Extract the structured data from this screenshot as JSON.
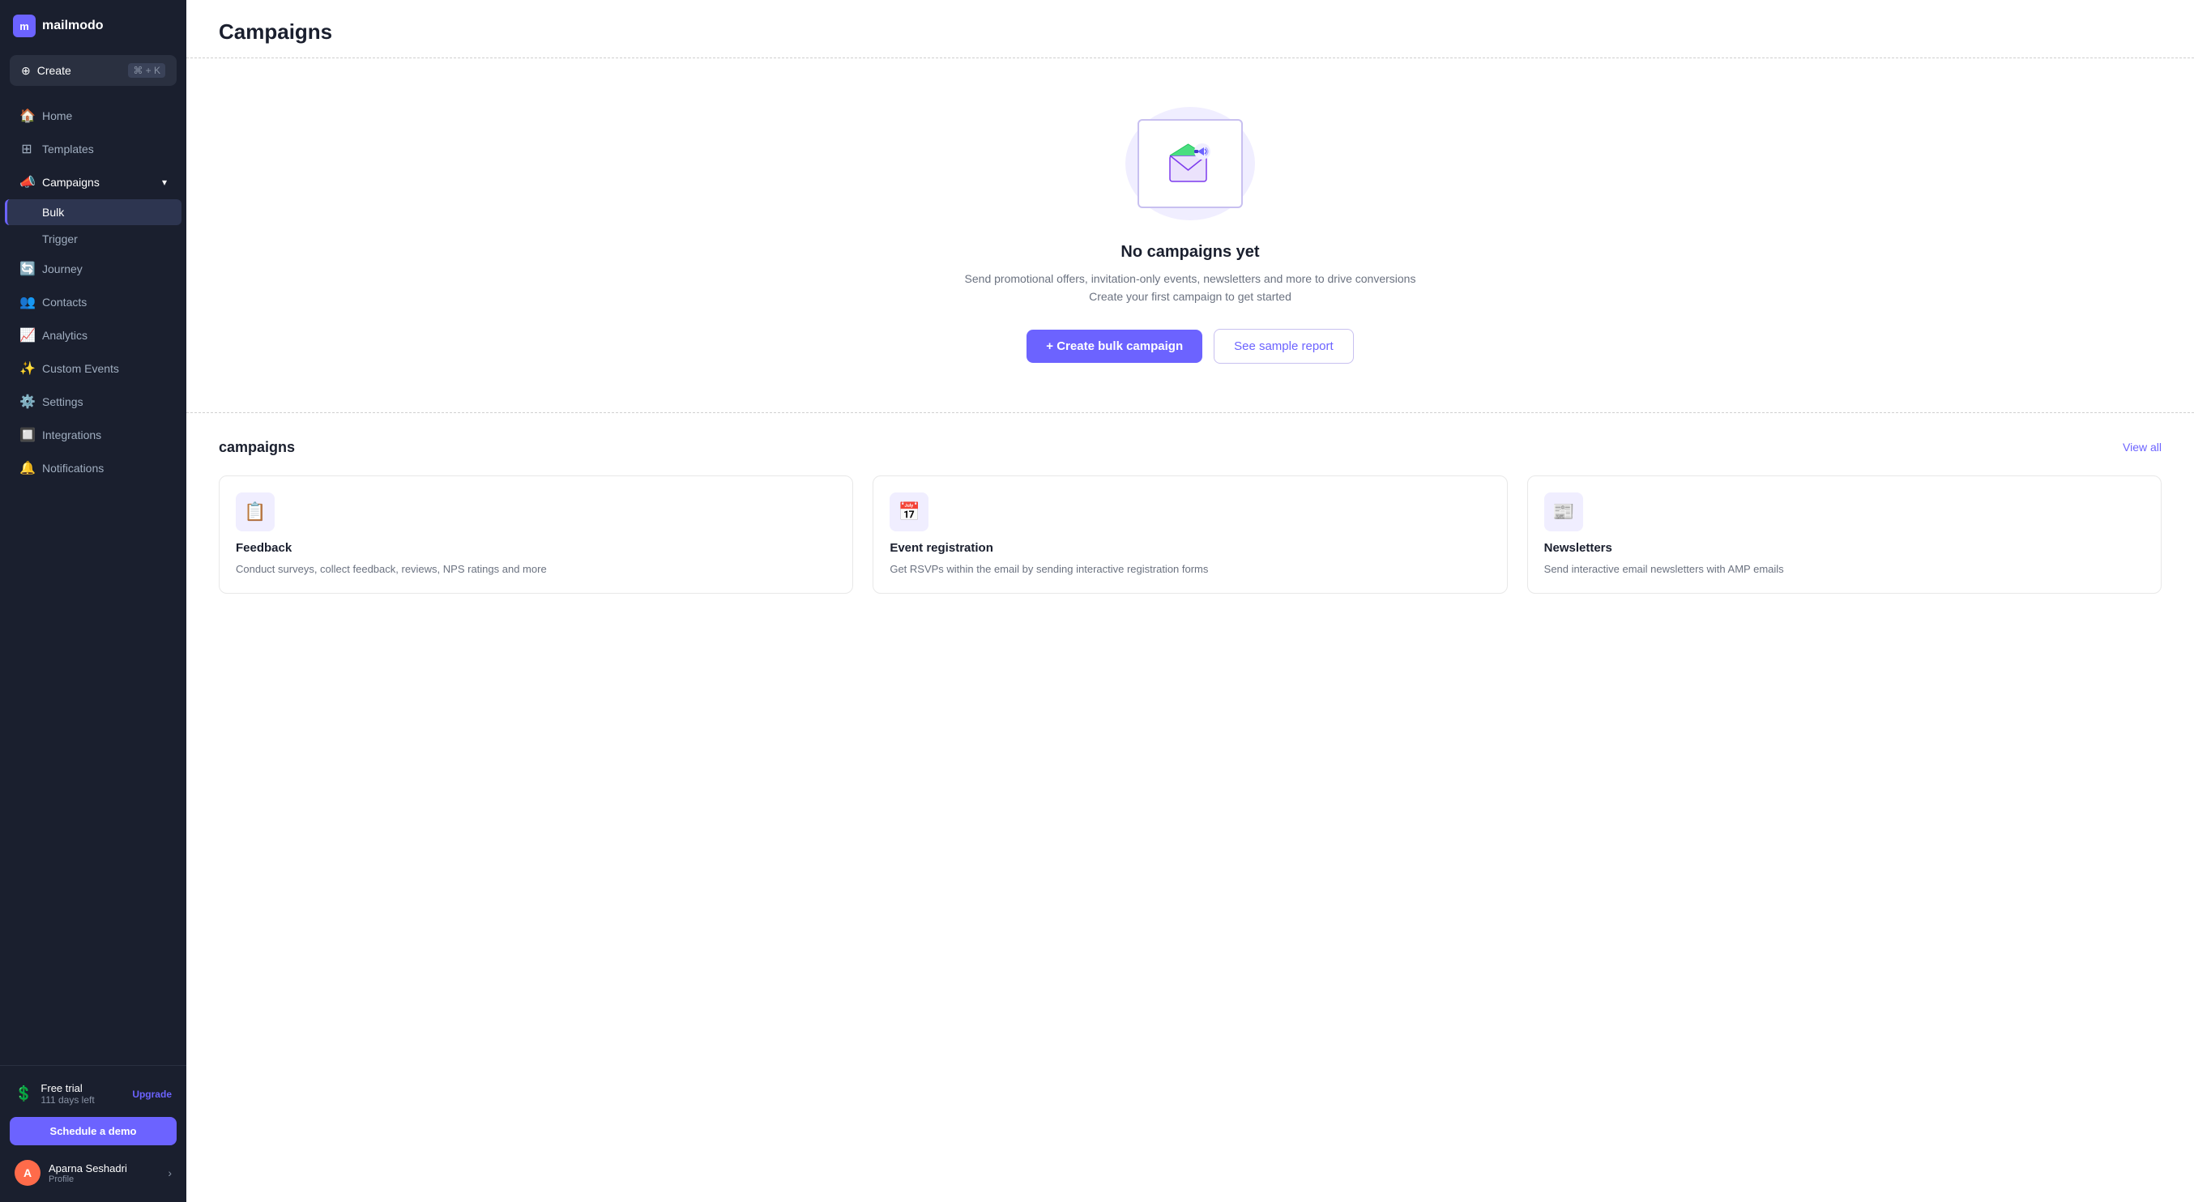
{
  "app": {
    "logo_text": "mailmodo",
    "logo_initial": "m"
  },
  "create_button": {
    "label": "Create",
    "shortcut": "⌘ + K"
  },
  "sidebar": {
    "items": [
      {
        "id": "home",
        "label": "Home",
        "icon": "🏠"
      },
      {
        "id": "templates",
        "label": "Templates",
        "icon": "⊞"
      },
      {
        "id": "campaigns",
        "label": "Campaigns",
        "icon": "📣",
        "has_chevron": true,
        "active": true
      },
      {
        "id": "journey",
        "label": "Journey",
        "icon": "🔄"
      },
      {
        "id": "contacts",
        "label": "Contacts",
        "icon": "👥"
      },
      {
        "id": "analytics",
        "label": "Analytics",
        "icon": "📈"
      },
      {
        "id": "custom_events",
        "label": "Custom Events",
        "icon": "✨"
      },
      {
        "id": "settings",
        "label": "Settings",
        "icon": "⚙️"
      },
      {
        "id": "integrations",
        "label": "Integrations",
        "icon": "🔲"
      },
      {
        "id": "notifications",
        "label": "Notifications",
        "icon": "🔔"
      }
    ],
    "sub_items": [
      {
        "id": "bulk",
        "label": "Bulk",
        "active": true
      },
      {
        "id": "trigger",
        "label": "Trigger"
      }
    ]
  },
  "trial": {
    "label": "Free trial",
    "days": "111 days left",
    "upgrade_label": "Upgrade"
  },
  "schedule_demo": {
    "label": "Schedule a demo"
  },
  "user": {
    "name": "Aparna Seshadri",
    "sub": "Profile",
    "avatar_initial": "A"
  },
  "page": {
    "title": "Campaigns"
  },
  "empty_state": {
    "title": "No campaigns yet",
    "desc_line1": "Send promotional offers, invitation-only events, newsletters and more to drive conversions",
    "desc_line2": "Create your first campaign to get started",
    "create_label": "+ Create bulk campaign",
    "sample_label": "See sample report"
  },
  "templates_section": {
    "title": "campaigns",
    "view_all_label": "View all",
    "cards": [
      {
        "title": "Feedback",
        "desc": "Conduct surveys, collect feedback, reviews, NPS ratings and more",
        "icon": "📋"
      },
      {
        "title": "Event registration",
        "desc": "Get RSVPs within the email by sending interactive registration forms",
        "icon": "📅"
      },
      {
        "title": "Newsletters",
        "desc": "Send interactive email newsletters with AMP emails",
        "icon": "📰"
      }
    ]
  }
}
